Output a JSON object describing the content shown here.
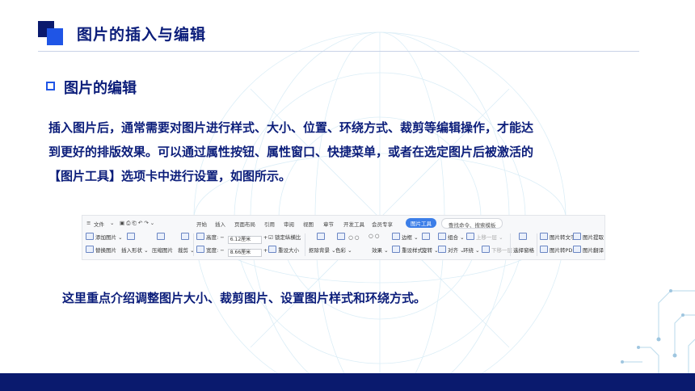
{
  "header": {
    "title": "图片的插入与编辑"
  },
  "section": {
    "title": "图片的编辑"
  },
  "body": {
    "lines": [
      "插入图片后，通常需要对图片进行样式、大小、位置、环绕方式、裁剪等编辑操作，才能达",
      "到更好的排版效果。可以通过属性按钮、属性窗口、快捷菜单，或者在选定图片后被激活的",
      "【图片工具】选项卡中进行设置，如图所示。"
    ],
    "note": "这里重点介绍调整图片大小、裁剪图片、设置图片样式和环绕方式。"
  },
  "ribbon": {
    "menu": "文件",
    "tabs": [
      "开始",
      "插入",
      "页面布局",
      "引用",
      "审阅",
      "视图",
      "章节",
      "开发工具",
      "会员专享"
    ],
    "active_tab": "图片工具",
    "search": "查找命令、搜索模板",
    "row1": {
      "add_picture": "添加图片",
      "height_label": "高度:",
      "height_value": "6.12厘米",
      "lock_ratio": "锁定纵横比",
      "border": "边框",
      "group": "组合",
      "move_up": "上移一层",
      "img_to_text": "图片转文字",
      "img_extract": "图片提取"
    },
    "row2": {
      "change_picture": "替换图片",
      "insert_shape": "插入形状",
      "compress": "压缩图片",
      "crop": "裁剪",
      "width_label": "宽度:",
      "width_value": "8.66厘米",
      "reset_size": "重设大小",
      "remove_bg": "抠除背景",
      "color": "色彩",
      "effect": "效果",
      "reset_style": "重设样式",
      "rotate": "旋转",
      "align": "对齐",
      "wrap": "环绕",
      "move_down": "下移一层",
      "select_pane": "选择窗格",
      "img_to_pdf": "图片转PDF",
      "img_translate": "图片翻译"
    }
  },
  "colors": {
    "primary": "#0b1d7a",
    "accent": "#1f55e6",
    "footer": "#0a1a6e",
    "active_tab": "#3c7ee8"
  }
}
